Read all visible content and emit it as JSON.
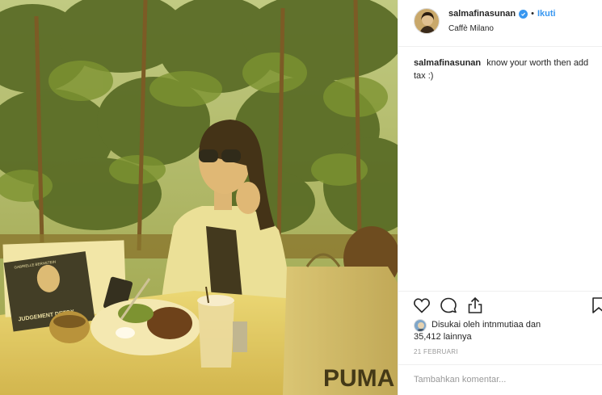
{
  "post": {
    "username": "salmafinasunan",
    "follow_label": "Ikuti",
    "dot": "•",
    "location": "Caffè Milano",
    "caption_user": "salmafinasunan",
    "caption_text": "know your worth then add tax :)",
    "likes_line1": "Disukai oleh intnmutiaa dan",
    "likes_line2": "35,412 lainnya",
    "date": "21 FEBRUARI",
    "comment_placeholder": "Tambahkan komentar..."
  },
  "photo": {
    "book_title": "JUDGEMENT DETOX",
    "book_author": "GABRIELLE BERNSTEIN",
    "bag_brand": "PUMA"
  },
  "icons": {
    "verified": "verified-badge-icon",
    "like": "heart-icon",
    "comment": "comment-bubble-icon",
    "share": "share-icon",
    "save": "bookmark-icon"
  },
  "colors": {
    "accent": "#3897f0",
    "text": "#262626",
    "muted": "#999999",
    "divider": "#efefef"
  }
}
